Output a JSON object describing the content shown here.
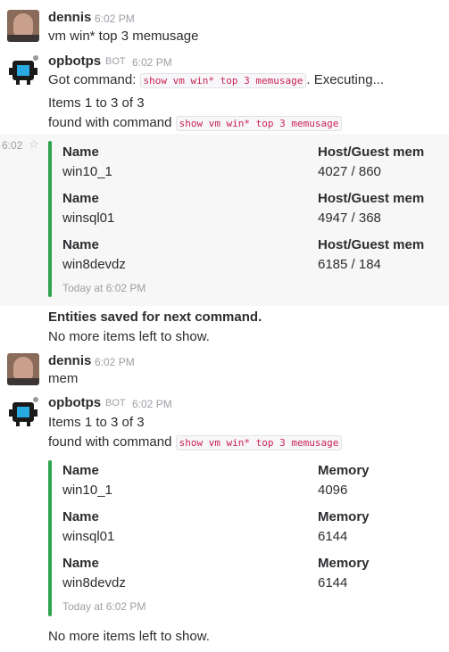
{
  "messages": [
    {
      "user": "dennis",
      "time": "6:02 PM",
      "text": "vm win* top 3 memusage"
    },
    {
      "user": "opbotps",
      "bot": "BOT",
      "time": "6:02 PM",
      "got_prefix": "Got command: ",
      "got_code": "show vm win* top 3 memusage",
      "got_suffix": ". Executing...",
      "items": "Items 1 to 3 of 3",
      "found_prefix": "found with command ",
      "found_code": "show vm win* top 3 memusage"
    },
    {
      "user": "dennis",
      "time": "6:02 PM",
      "text": "mem"
    },
    {
      "user": "opbotps",
      "bot": "BOT",
      "time": "6:02 PM",
      "items": "Items 1 to 3 of 3",
      "found_prefix": "found with command ",
      "found_code": "show vm win* top 3 memusage"
    }
  ],
  "attachment1": {
    "side_time": "6:02",
    "rows": [
      {
        "name_label": "Name",
        "name": "win10_1",
        "mem_label": "Host/Guest mem",
        "mem": "4027 / 860"
      },
      {
        "name_label": "Name",
        "name": "winsql01",
        "mem_label": "Host/Guest mem",
        "mem": "4947 / 368"
      },
      {
        "name_label": "Name",
        "name": "win8devdz",
        "mem_label": "Host/Guest mem",
        "mem": "6185 / 184"
      }
    ],
    "footer": "Today at 6:02 PM"
  },
  "entities_saved": "Entities saved for next command.",
  "no_more_1": "No more items left to show.",
  "attachment2": {
    "rows": [
      {
        "name_label": "Name",
        "name": "win10_1",
        "mem_label": "Memory",
        "mem": "4096"
      },
      {
        "name_label": "Name",
        "name": "winsql01",
        "mem_label": "Memory",
        "mem": "6144"
      },
      {
        "name_label": "Name",
        "name": "win8devdz",
        "mem_label": "Memory",
        "mem": "6144"
      }
    ],
    "footer": "Today at 6:02 PM"
  },
  "no_more_2": "No more items left to show.",
  "colors": {
    "accent_bar": "#2fa44f",
    "code_text": "#cc2255",
    "timestamp": "#9e9ea6",
    "highlight_bg": "#f7f7f7"
  },
  "icons": {
    "bot_avatar": "robot-icon",
    "star": "star-icon"
  }
}
